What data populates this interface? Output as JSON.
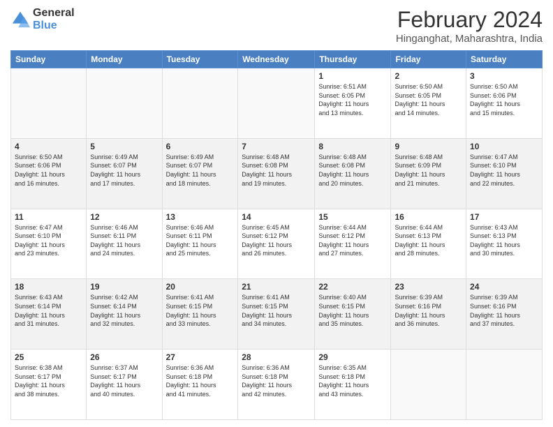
{
  "logo": {
    "line1": "General",
    "line2": "Blue"
  },
  "title": {
    "month_year": "February 2024",
    "location": "Hinganghat, Maharashtra, India"
  },
  "weekdays": [
    "Sunday",
    "Monday",
    "Tuesday",
    "Wednesday",
    "Thursday",
    "Friday",
    "Saturday"
  ],
  "weeks": [
    [
      {
        "day": "",
        "info": ""
      },
      {
        "day": "",
        "info": ""
      },
      {
        "day": "",
        "info": ""
      },
      {
        "day": "",
        "info": ""
      },
      {
        "day": "1",
        "info": "Sunrise: 6:51 AM\nSunset: 6:05 PM\nDaylight: 11 hours\nand 13 minutes."
      },
      {
        "day": "2",
        "info": "Sunrise: 6:50 AM\nSunset: 6:05 PM\nDaylight: 11 hours\nand 14 minutes."
      },
      {
        "day": "3",
        "info": "Sunrise: 6:50 AM\nSunset: 6:06 PM\nDaylight: 11 hours\nand 15 minutes."
      }
    ],
    [
      {
        "day": "4",
        "info": "Sunrise: 6:50 AM\nSunset: 6:06 PM\nDaylight: 11 hours\nand 16 minutes."
      },
      {
        "day": "5",
        "info": "Sunrise: 6:49 AM\nSunset: 6:07 PM\nDaylight: 11 hours\nand 17 minutes."
      },
      {
        "day": "6",
        "info": "Sunrise: 6:49 AM\nSunset: 6:07 PM\nDaylight: 11 hours\nand 18 minutes."
      },
      {
        "day": "7",
        "info": "Sunrise: 6:48 AM\nSunset: 6:08 PM\nDaylight: 11 hours\nand 19 minutes."
      },
      {
        "day": "8",
        "info": "Sunrise: 6:48 AM\nSunset: 6:08 PM\nDaylight: 11 hours\nand 20 minutes."
      },
      {
        "day": "9",
        "info": "Sunrise: 6:48 AM\nSunset: 6:09 PM\nDaylight: 11 hours\nand 21 minutes."
      },
      {
        "day": "10",
        "info": "Sunrise: 6:47 AM\nSunset: 6:10 PM\nDaylight: 11 hours\nand 22 minutes."
      }
    ],
    [
      {
        "day": "11",
        "info": "Sunrise: 6:47 AM\nSunset: 6:10 PM\nDaylight: 11 hours\nand 23 minutes."
      },
      {
        "day": "12",
        "info": "Sunrise: 6:46 AM\nSunset: 6:11 PM\nDaylight: 11 hours\nand 24 minutes."
      },
      {
        "day": "13",
        "info": "Sunrise: 6:46 AM\nSunset: 6:11 PM\nDaylight: 11 hours\nand 25 minutes."
      },
      {
        "day": "14",
        "info": "Sunrise: 6:45 AM\nSunset: 6:12 PM\nDaylight: 11 hours\nand 26 minutes."
      },
      {
        "day": "15",
        "info": "Sunrise: 6:44 AM\nSunset: 6:12 PM\nDaylight: 11 hours\nand 27 minutes."
      },
      {
        "day": "16",
        "info": "Sunrise: 6:44 AM\nSunset: 6:13 PM\nDaylight: 11 hours\nand 28 minutes."
      },
      {
        "day": "17",
        "info": "Sunrise: 6:43 AM\nSunset: 6:13 PM\nDaylight: 11 hours\nand 30 minutes."
      }
    ],
    [
      {
        "day": "18",
        "info": "Sunrise: 6:43 AM\nSunset: 6:14 PM\nDaylight: 11 hours\nand 31 minutes."
      },
      {
        "day": "19",
        "info": "Sunrise: 6:42 AM\nSunset: 6:14 PM\nDaylight: 11 hours\nand 32 minutes."
      },
      {
        "day": "20",
        "info": "Sunrise: 6:41 AM\nSunset: 6:15 PM\nDaylight: 11 hours\nand 33 minutes."
      },
      {
        "day": "21",
        "info": "Sunrise: 6:41 AM\nSunset: 6:15 PM\nDaylight: 11 hours\nand 34 minutes."
      },
      {
        "day": "22",
        "info": "Sunrise: 6:40 AM\nSunset: 6:15 PM\nDaylight: 11 hours\nand 35 minutes."
      },
      {
        "day": "23",
        "info": "Sunrise: 6:39 AM\nSunset: 6:16 PM\nDaylight: 11 hours\nand 36 minutes."
      },
      {
        "day": "24",
        "info": "Sunrise: 6:39 AM\nSunset: 6:16 PM\nDaylight: 11 hours\nand 37 minutes."
      }
    ],
    [
      {
        "day": "25",
        "info": "Sunrise: 6:38 AM\nSunset: 6:17 PM\nDaylight: 11 hours\nand 38 minutes."
      },
      {
        "day": "26",
        "info": "Sunrise: 6:37 AM\nSunset: 6:17 PM\nDaylight: 11 hours\nand 40 minutes."
      },
      {
        "day": "27",
        "info": "Sunrise: 6:36 AM\nSunset: 6:18 PM\nDaylight: 11 hours\nand 41 minutes."
      },
      {
        "day": "28",
        "info": "Sunrise: 6:36 AM\nSunset: 6:18 PM\nDaylight: 11 hours\nand 42 minutes."
      },
      {
        "day": "29",
        "info": "Sunrise: 6:35 AM\nSunset: 6:18 PM\nDaylight: 11 hours\nand 43 minutes."
      },
      {
        "day": "",
        "info": ""
      },
      {
        "day": "",
        "info": ""
      }
    ]
  ]
}
